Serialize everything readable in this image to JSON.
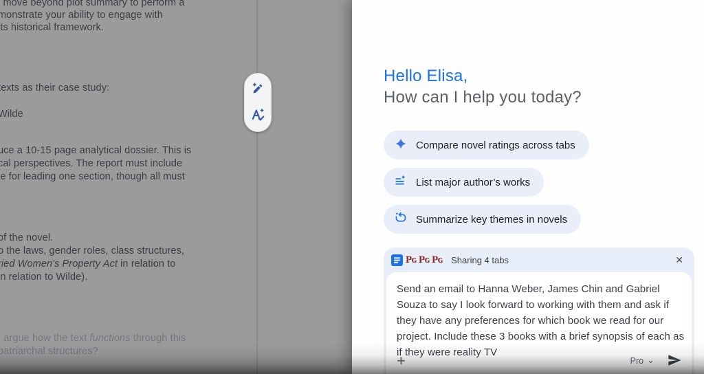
{
  "colors": {
    "accent_blue": "#1a73e8",
    "chip_background": "#e9eef8",
    "card_background": "#e8eef9",
    "doc_dimmed_background": "#9b9b9b",
    "gutenberg_red": "#8d2b2b",
    "greeting_blue": "#1a73e8",
    "subtitle_gray": "#5c6064"
  },
  "doc": {
    "lines": [
      {
        "pre": "l move beyond plot summary to perform a"
      },
      {
        "pre": "monstrate your ability to engage with"
      },
      {
        "pre": "its historical framework."
      },
      {
        "pre": "texts as their case study:"
      },
      {
        "pre": "Wilde"
      },
      {
        "pre": "uce a 10-15 page analytical dossier. This is"
      },
      {
        "pre": "cal perspectives. The report must include"
      },
      {
        "pre": "le for leading one section, though all must"
      },
      {
        "pre": "of the novel."
      },
      {
        "pre": "o the laws, gender roles, class structures,"
      },
      {
        "italic": "ried Women's Property Act",
        "post": " in relation to"
      },
      {
        "pre": "in relation to Wilde)."
      },
      {
        "pre": "; argue how the text ",
        "italic": "functions",
        "post": " through this"
      },
      {
        "pre": "patriarchal structures?"
      }
    ]
  },
  "panel": {
    "greeting": "Hello Elisa,",
    "subtitle": "How can I help you today?",
    "chips": [
      {
        "label": "Compare novel ratings across tabs",
        "icon": "sparkle-icon"
      },
      {
        "label": "List major author’s works",
        "icon": "summarize-sparkle-icon"
      },
      {
        "label": "Summarize key themes in novels",
        "icon": "loop-sparkle-icon"
      }
    ],
    "share_card": {
      "title": "Sharing 4 tabs",
      "favicons": [
        "google-docs",
        "gutenberg",
        "gutenberg",
        "gutenberg"
      ],
      "prompt": "Send an email to Hanna Weber, James Chin and Gabriel Souza to say I look forward to working with them and ask if they have any preferences for which book we read for our project. Include these 3 books with a brief synopsis of each as if they were reality TV",
      "model": "Pro"
    },
    "icons": {
      "close": "✕",
      "plus": "+",
      "chevron": "⌄",
      "gutenberg": "Pɢ"
    }
  }
}
